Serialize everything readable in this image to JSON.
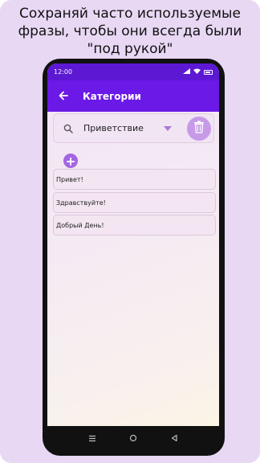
{
  "promo": {
    "line1": "Сохраняй часто используемые",
    "line2": "фразы, чтобы они всегда были",
    "line3": "\"под рукой\""
  },
  "status_bar": {
    "time": "12:00"
  },
  "app_bar": {
    "title": "Категории"
  },
  "category_selector": {
    "selected": "Приветствие"
  },
  "phrases": [
    {
      "text": "Привет!"
    },
    {
      "text": "Здравствуйте!"
    },
    {
      "text": "Добрый День!"
    }
  ],
  "colors": {
    "primary": "#6a19e6",
    "status_bar": "#5d18d4",
    "accent": "#a565e3",
    "delete_button": "#c79ae8",
    "promo_background": "#e8d8f4"
  },
  "icons": {
    "back": "arrow-left-icon",
    "search": "search-icon",
    "dropdown": "chevron-down-icon",
    "delete": "trash-icon",
    "add": "plus-icon",
    "nav_menu": "menu-icon",
    "nav_home": "home-icon",
    "nav_back": "back-triangle-icon"
  }
}
